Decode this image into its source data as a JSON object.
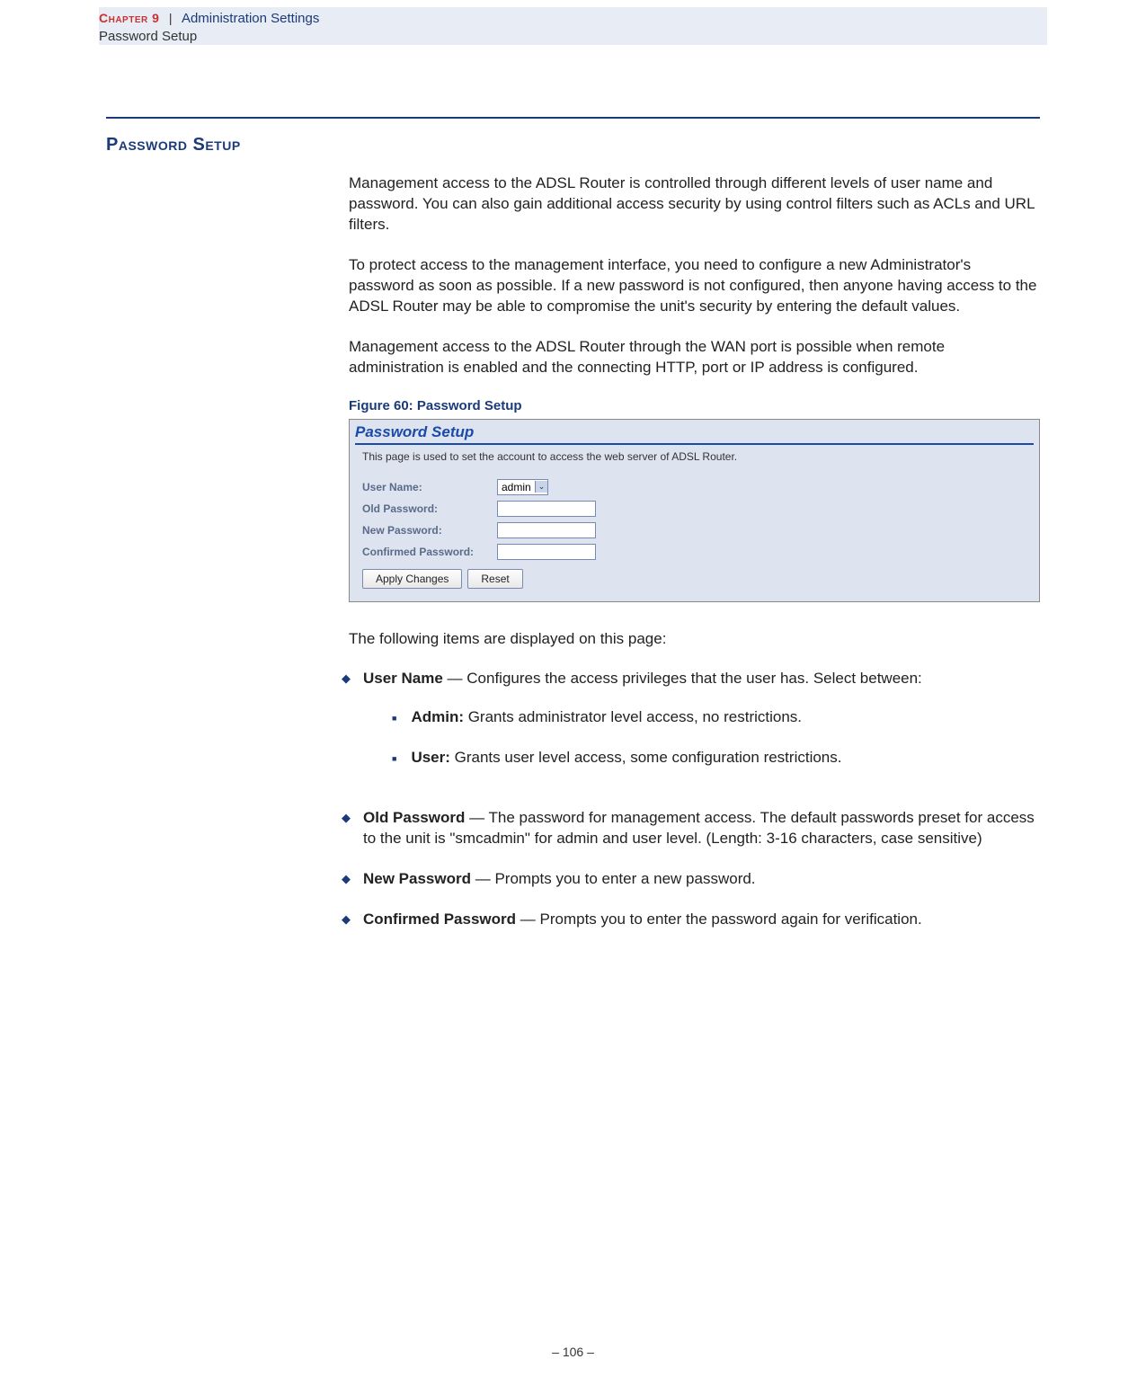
{
  "header": {
    "chapter_label": "Chapter 9",
    "separator": "|",
    "chapter_title": "Administration Settings",
    "subtitle": "Password Setup"
  },
  "section": {
    "title": "Password Setup",
    "para1": "Management access to the ADSL Router is controlled through different levels of user name and password. You can also gain additional access security by using control filters such as ACLs and URL filters.",
    "para2": "To protect access to the management interface, you need to configure a new Administrator's password as soon as possible. If a new password is not configured, then anyone having access to the ADSL Router may be able to compromise the unit's security by entering the default values.",
    "para3": "Management access to the ADSL Router through the WAN port is possible when remote administration is enabled and the connecting HTTP, port or IP address is configured."
  },
  "figure": {
    "caption": "Figure 60:  Password Setup",
    "title": "Password Setup",
    "desc": "This page is used to set the account to access the web server of ADSL Router.",
    "labels": {
      "username": "User Name:",
      "oldpw": "Old Password:",
      "newpw": "New Password:",
      "confpw": "Confirmed Password:"
    },
    "username_value": "admin",
    "btn_apply": "Apply Changes",
    "btn_reset": "Reset"
  },
  "items_intro": "The following items are displayed on this page:",
  "items": {
    "username_label": "User Name",
    "username_text": " — Configures the access privileges that the user has. Select between:",
    "admin_label": "Admin:",
    "admin_text": " Grants administrator level access, no restrictions.",
    "user_label": "User:",
    "user_text": " Grants user level access, some configuration restrictions.",
    "oldpw_label": "Old Password",
    "oldpw_text": " — The password for management access. The default passwords preset for access to the unit is \"smcadmin\" for admin and user level. (Length: 3-16 characters, case sensitive)",
    "newpw_label": "New Password",
    "newpw_text": " — Prompts you to enter a new password.",
    "confpw_label": "Confirmed Password",
    "confpw_text": " — Prompts you to enter the password again for verification."
  },
  "footer": {
    "page": "–  106  –"
  }
}
